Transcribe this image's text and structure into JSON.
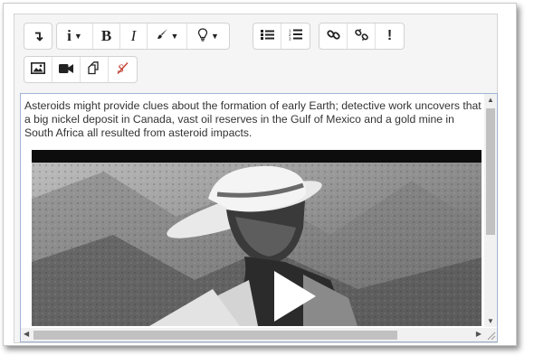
{
  "toolbar": {
    "row1": [
      {
        "name": "collapse-toolbar-button",
        "icon": "arrow-return-icon",
        "glyph": "↴"
      },
      {
        "name": "paragraph-styles-button",
        "icon": "info-icon",
        "glyph": "i",
        "caret": "▼"
      },
      {
        "name": "bold-button",
        "icon": "bold-icon",
        "glyph": "B"
      },
      {
        "name": "italic-button",
        "icon": "italic-icon",
        "glyph": "I"
      },
      {
        "name": "font-color-button",
        "icon": "paintbrush-icon",
        "caret": "▼"
      },
      {
        "name": "highlight-button",
        "icon": "lightbulb-icon",
        "glyph": "💡",
        "caret": "▼"
      },
      {
        "name": "unordered-list-button",
        "icon": "bullet-list-icon"
      },
      {
        "name": "ordered-list-button",
        "icon": "numbered-list-icon"
      },
      {
        "name": "insert-link-button",
        "icon": "link-icon"
      },
      {
        "name": "remove-link-button",
        "icon": "unlink-icon"
      },
      {
        "name": "accessibility-checker-button",
        "icon": "exclamation-icon",
        "glyph": "!"
      }
    ],
    "row2": [
      {
        "name": "insert-image-button",
        "icon": "image-icon"
      },
      {
        "name": "insert-media-button",
        "icon": "video-camera-icon"
      },
      {
        "name": "manage-files-button",
        "icon": "copy-files-icon"
      },
      {
        "name": "html-toggle-button",
        "icon": "html-source-icon"
      }
    ]
  },
  "content": {
    "paragraph": "Asteroids might provide clues about the formation of early Earth; detective work uncovers that a big nickel deposit in Canada, vast oil reserves in the Gulf of Mexico and a gold mine in South Africa all resulted from asteroid impacts."
  },
  "video": {
    "play_icon": "play-icon",
    "scene_description_icon": "video-thumbnail"
  },
  "colors": {
    "toolbar_bg": "#f5f5f5",
    "content_border": "#9fb4d4",
    "scroll_thumb": "#c1c1c1",
    "html_icon_red": "#c0392b"
  }
}
